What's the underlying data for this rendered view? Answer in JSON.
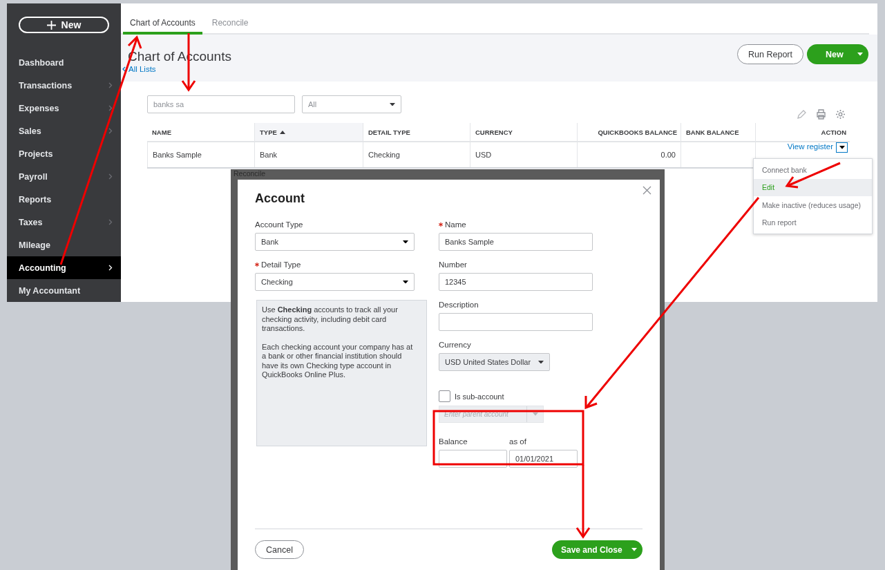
{
  "sidebar": {
    "new_button": "New",
    "items": [
      {
        "label": "Dashboard",
        "has_submenu": false,
        "selected": false
      },
      {
        "label": "Transactions",
        "has_submenu": true,
        "selected": false
      },
      {
        "label": "Expenses",
        "has_submenu": true,
        "selected": false
      },
      {
        "label": "Sales",
        "has_submenu": true,
        "selected": false
      },
      {
        "label": "Projects",
        "has_submenu": false,
        "selected": false
      },
      {
        "label": "Payroll",
        "has_submenu": true,
        "selected": false
      },
      {
        "label": "Reports",
        "has_submenu": false,
        "selected": false
      },
      {
        "label": "Taxes",
        "has_submenu": true,
        "selected": false
      },
      {
        "label": "Mileage",
        "has_submenu": false,
        "selected": false
      },
      {
        "label": "Accounting",
        "has_submenu": true,
        "selected": true
      },
      {
        "label": "My Accountant",
        "has_submenu": false,
        "selected": false
      }
    ]
  },
  "tabs": [
    {
      "label": "Chart of Accounts",
      "selected": true
    },
    {
      "label": "Reconcile",
      "selected": false
    }
  ],
  "page": {
    "title": "Chart of Accounts",
    "back_link": "All Lists",
    "run_report_button": "Run Report",
    "new_button": "New"
  },
  "filter": {
    "search_value": "banks sa",
    "type_value": "All"
  },
  "table": {
    "columns": [
      {
        "label": "NAME",
        "sorted": false
      },
      {
        "label": "TYPE",
        "sorted": true
      },
      {
        "label": "DETAIL TYPE",
        "sorted": false
      },
      {
        "label": "CURRENCY",
        "sorted": false
      },
      {
        "label": "QUICKBOOKS BALANCE",
        "sorted": false
      },
      {
        "label": "BANK BALANCE",
        "sorted": false
      },
      {
        "label": "ACTION",
        "sorted": false
      }
    ],
    "rows": [
      {
        "cells": [
          "Banks Sample",
          "Bank",
          "Checking",
          "USD",
          "0.00",
          ""
        ],
        "action": "View register"
      }
    ]
  },
  "action_menu": {
    "items": [
      {
        "label": "Connect bank",
        "selected": false
      },
      {
        "label": "Edit",
        "selected": true
      },
      {
        "label": "Make inactive (reduces usage)",
        "selected": false
      },
      {
        "label": "Run report",
        "selected": false
      }
    ]
  },
  "backdrop_text": "Reconcile",
  "dialog": {
    "title": "Account",
    "account_type": {
      "label": "Account Type",
      "required": false,
      "value": "Bank"
    },
    "detail_type": {
      "label": "Detail Type",
      "required": true,
      "value": "Checking"
    },
    "help_paragraphs": [
      "Use **Checking** accounts to track all your checking activity, including debit card transactions.",
      "Each checking account your company has at a bank or other financial institution should have its own Checking type account in QuickBooks Online Plus."
    ],
    "name": {
      "label": "Name",
      "required": true,
      "value": "Banks Sample"
    },
    "number": {
      "label": "Number",
      "required": false,
      "value": "12345"
    },
    "description": {
      "label": "Description",
      "required": false
    },
    "currency": {
      "label": "Currency",
      "value": "USD United States Dollar",
      "disabled": true
    },
    "sub_account": {
      "label": "Is sub-account",
      "checked": false
    },
    "parent_account": {
      "placeholder": "Enter parent account",
      "disabled": true
    },
    "balance": {
      "label": "Balance"
    },
    "as_of": {
      "label": "as of",
      "value": "01/01/2021"
    },
    "cancel_button": "Cancel",
    "save_button": "Save and Close"
  }
}
